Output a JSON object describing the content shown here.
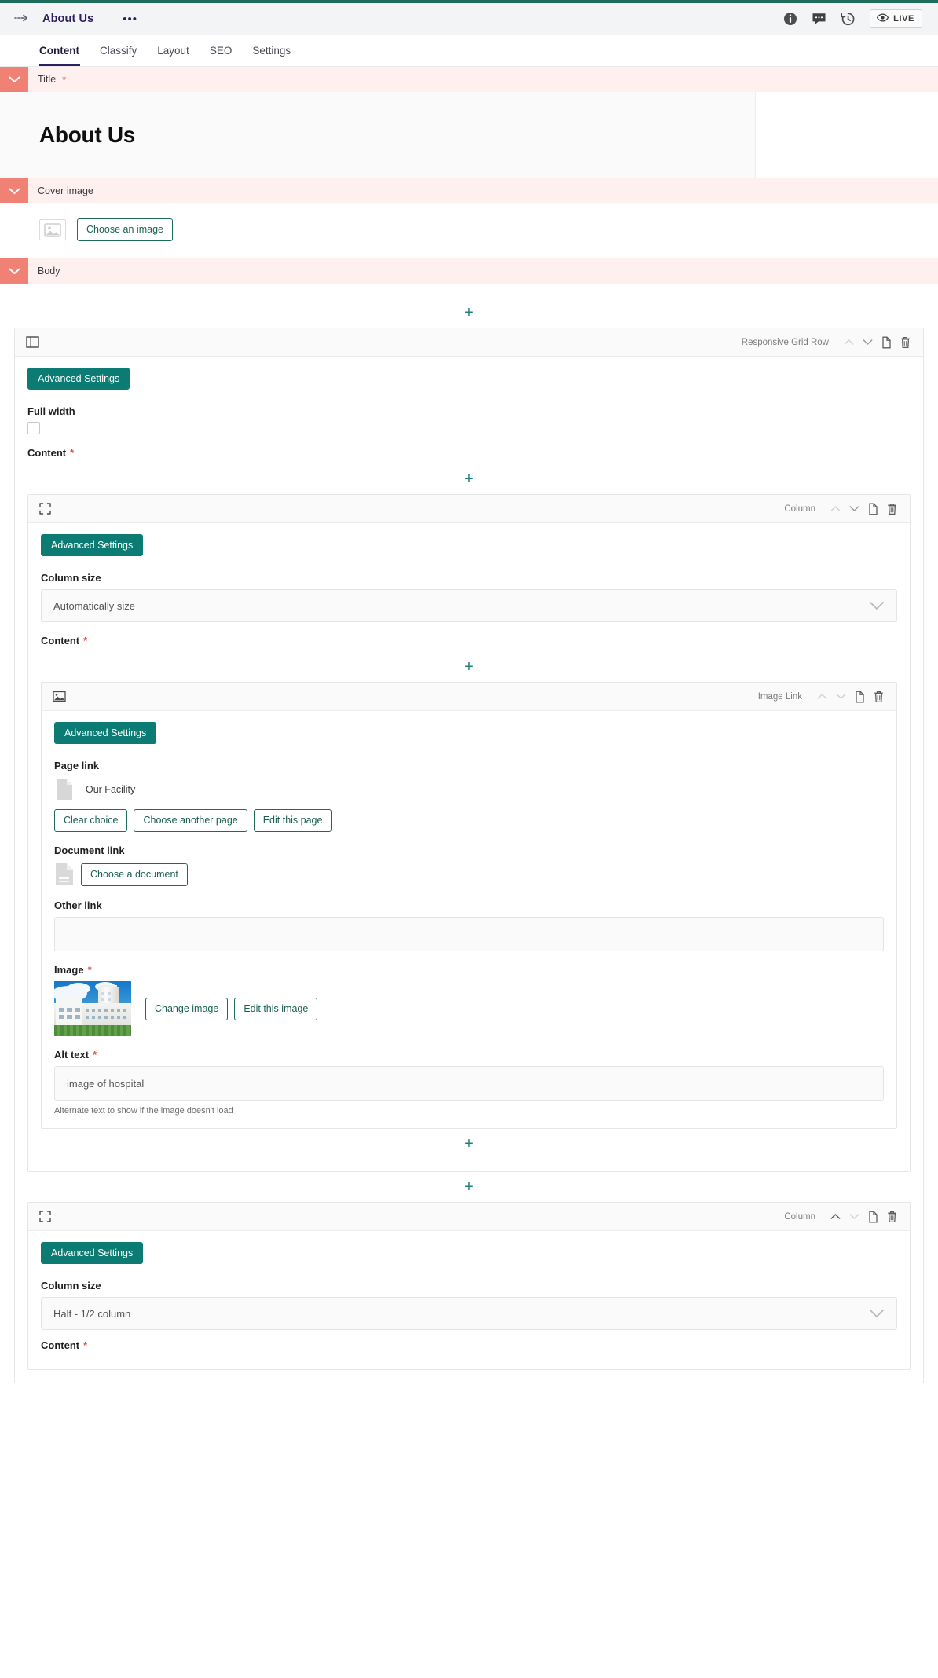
{
  "header": {
    "breadcrumb_icon": "dashed-arrow-icon",
    "page_title": "About Us",
    "more_menu": "•••",
    "icons": [
      {
        "name": "info-icon",
        "label": "Info"
      },
      {
        "name": "comments-icon",
        "label": "Comments"
      },
      {
        "name": "history-icon",
        "label": "History"
      }
    ],
    "live_label": "LIVE"
  },
  "tabs": [
    {
      "label": "Content",
      "active": true
    },
    {
      "label": "Classify",
      "active": false
    },
    {
      "label": "Layout",
      "active": false
    },
    {
      "label": "SEO",
      "active": false
    },
    {
      "label": "Settings",
      "active": false
    }
  ],
  "sections": {
    "title": {
      "label": "Title",
      "required": true,
      "value": "About Us"
    },
    "cover_image": {
      "label": "Cover image",
      "required": false,
      "choose_label": "Choose an image"
    },
    "body": {
      "label": "Body",
      "required": false
    }
  },
  "grid_row": {
    "type_label": "Responsive Grid Row",
    "advanced_settings": "Advanced Settings",
    "full_width_label": "Full width",
    "full_width_checked": false,
    "content_label": "Content",
    "content_required": true
  },
  "column_one": {
    "type_label": "Column",
    "advanced_settings": "Advanced Settings",
    "column_size_label": "Column size",
    "column_size_value": "Automatically size",
    "content_label": "Content",
    "content_required": true
  },
  "image_link": {
    "type_label": "Image Link",
    "advanced_settings": "Advanced Settings",
    "page_link_label": "Page link",
    "page_link_value": "Our Facility",
    "clear_choice": "Clear choice",
    "choose_another_page": "Choose another page",
    "edit_this_page": "Edit this page",
    "document_link_label": "Document link",
    "choose_a_document": "Choose a document",
    "other_link_label": "Other link",
    "other_link_value": "",
    "other_link_placeholder": "",
    "image_label": "Image",
    "image_required": true,
    "image_alt_preview": "image of hospital",
    "change_image": "Change image",
    "edit_this_image": "Edit this image",
    "alt_text_label": "Alt text",
    "alt_text_required": true,
    "alt_text_value": "image of hospital",
    "alt_text_help": "Alternate text to show if the image doesn't load"
  },
  "column_two": {
    "type_label": "Column",
    "advanced_settings": "Advanced Settings",
    "column_size_label": "Column size",
    "column_size_value": "Half - 1/2 column",
    "content_label": "Content"
  },
  "add_button_glyph": "+",
  "colors": {
    "accent_teal": "#0b7b73",
    "brand_green": "#1d6b58",
    "section_salmon": "#ef8275",
    "section_bg": "#fdf0ee",
    "required_red": "#e04a43",
    "title_purple": "#2e1f5e"
  }
}
